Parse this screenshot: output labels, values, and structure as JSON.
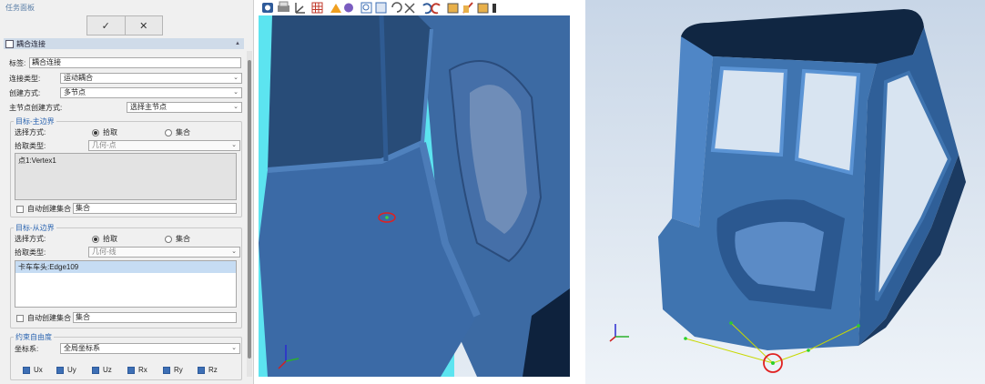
{
  "panel": {
    "title": "任务面板",
    "confirm": "✓",
    "cancel": "✕",
    "section_title": "耦合连接",
    "tag_label": "标签:",
    "tag_value": "耦合连接",
    "conn_type_label": "连接类型:",
    "conn_type_value": "运动耦合",
    "create_mode_label": "创建方式:",
    "create_mode_value": "多节点",
    "master_mode_label": "主节点创建方式:",
    "master_mode_value": "选择主节点",
    "master": {
      "title": "目标-主边界",
      "select_label": "选择方式:",
      "opt_pick": "拾取",
      "opt_set": "集合",
      "pick_type_label": "拾取类型:",
      "pick_type_value": "几何-点",
      "list_item": "点1:Vertex1",
      "auto_label": "自动创建集合",
      "set_value": "集合"
    },
    "slave": {
      "title": "目标-从边界",
      "select_label": "选择方式:",
      "opt_pick": "拾取",
      "opt_set": "集合",
      "pick_type_label": "拾取类型:",
      "pick_type_value": "几何-线",
      "list_item": "卡车车头:Edge109",
      "auto_label": "自动创建集合",
      "set_value": "集合"
    },
    "dof": {
      "title": "约束自由度",
      "coord_label": "坐标系:",
      "coord_value": "全局坐标系",
      "checks": [
        "Ux",
        "Uy",
        "Uz",
        "Rx",
        "Ry",
        "Rz"
      ]
    }
  },
  "colors": {
    "accent": "#3d6fb5",
    "model": "#3f74b0",
    "highlight": "#57e6f2",
    "mark": "#e02020"
  }
}
